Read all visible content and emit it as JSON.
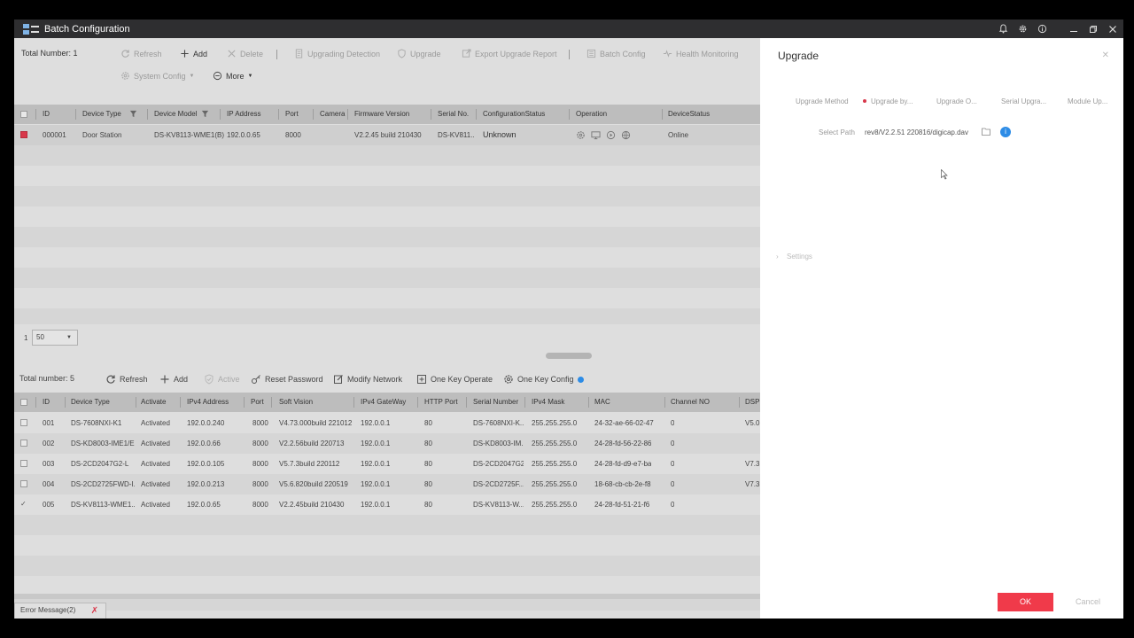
{
  "window": {
    "title": "Batch Configuration"
  },
  "top_toolbar": {
    "total_label": "Total Number: 1",
    "refresh": "Refresh",
    "add": "Add",
    "delete": "Delete",
    "upgrading_detection": "Upgrading Detection",
    "upgrade": "Upgrade",
    "export_upgrade_report": "Export Upgrade Report",
    "batch_config": "Batch Config",
    "health_monitoring": "Health Monitoring",
    "system_config": "System Config",
    "more": "More"
  },
  "top_table": {
    "columns": [
      "ID",
      "Device Type",
      "Device Model",
      "IP Address",
      "Port",
      "Camera",
      "Firmware Version",
      "Serial No.",
      "ConfigurationStatus",
      "Operation",
      "DeviceStatus"
    ],
    "rows": [
      {
        "id": "000001",
        "device_type": "Door Station",
        "device_model": "DS-KV8113-WME1(B)",
        "ip": "192.0.0.65",
        "port": "8000",
        "camera": "",
        "firmware": "V2.2.45 build 210430",
        "serial": "DS-KV811...",
        "config_status": "Unknown",
        "device_status": "Online"
      }
    ]
  },
  "pager": {
    "page": "1",
    "page_size": "50"
  },
  "bottom_toolbar": {
    "total_label": "Total number: 5",
    "refresh": "Refresh",
    "add": "Add",
    "active": "Active",
    "reset_password": "Reset Password",
    "modify_network": "Modify Network",
    "one_key_operate": "One Key Operate",
    "one_key_config": "One Key Config"
  },
  "bottom_table": {
    "columns": [
      "ID",
      "Device Type",
      "Activate",
      "IPv4 Address",
      "Port",
      "Soft Vision",
      "IPv4 GateWay",
      "HTTP Port",
      "Serial Number",
      "IPv4 Mask",
      "MAC",
      "Channel NO",
      "DSP V"
    ],
    "rows": [
      {
        "id": "001",
        "device_type": "DS-7608NXI-K1",
        "activate": "Activated",
        "ip": "192.0.0.240",
        "port": "8000",
        "soft": "V4.73.000build 221012",
        "gateway": "192.0.0.1",
        "http": "80",
        "serial": "DS-7608NXI-K...",
        "mask": "255.255.255.0",
        "mac": "24-32-ae-66-02-47",
        "channel": "0",
        "dsp": "V5.0,"
      },
      {
        "id": "002",
        "device_type": "DS-KD8003-IME1/EU",
        "activate": "Activated",
        "ip": "192.0.0.66",
        "port": "8000",
        "soft": "V2.2.56build 220713",
        "gateway": "192.0.0.1",
        "http": "80",
        "serial": "DS-KD8003-IM...",
        "mask": "255.255.255.0",
        "mac": "24-28-fd-56-22-86",
        "channel": "0",
        "dsp": ""
      },
      {
        "id": "003",
        "device_type": "DS-2CD2047G2-L",
        "activate": "Activated",
        "ip": "192.0.0.105",
        "port": "8000",
        "soft": "V5.7.3build 220112",
        "gateway": "192.0.0.1",
        "http": "80",
        "serial": "DS-2CD2047G2...",
        "mask": "255.255.255.0",
        "mac": "24-28-fd-d9-e7-ba",
        "channel": "0",
        "dsp": "V7.3"
      },
      {
        "id": "004",
        "device_type": "DS-2CD2725FWD-I...",
        "activate": "Activated",
        "ip": "192.0.0.213",
        "port": "8000",
        "soft": "V5.6.820build 220519",
        "gateway": "192.0.0.1",
        "http": "80",
        "serial": "DS-2CD2725F...",
        "mask": "255.255.255.0",
        "mac": "18-68-cb-cb-2e-f8",
        "channel": "0",
        "dsp": "V7.3"
      },
      {
        "id": "005",
        "device_type": "DS-KV8113-WME1...",
        "activate": "Activated",
        "ip": "192.0.0.65",
        "port": "8000",
        "soft": "V2.2.45build 210430",
        "gateway": "192.0.0.1",
        "http": "80",
        "serial": "DS-KV8113-W...",
        "mask": "255.255.255.0",
        "mac": "24-28-fd-51-21-f6",
        "channel": "0",
        "dsp": ""
      }
    ]
  },
  "error_tab": {
    "label": "Error Message(2)"
  },
  "upgrade_panel": {
    "title": "Upgrade",
    "method_label": "Upgrade Method",
    "options": [
      "Upgrade by...",
      "Upgrade O...",
      "Serial Upgra...",
      "Module Up..."
    ],
    "path_label": "Select Path",
    "path_value": "rev8/V2.2.51 220816/digicap.dav",
    "settings_label": "Settings",
    "ok": "OK",
    "cancel": "Cancel"
  },
  "colors": {
    "accent": "#f03a4a",
    "info": "#2d8ce6",
    "titlebar": "#2e2e30"
  }
}
